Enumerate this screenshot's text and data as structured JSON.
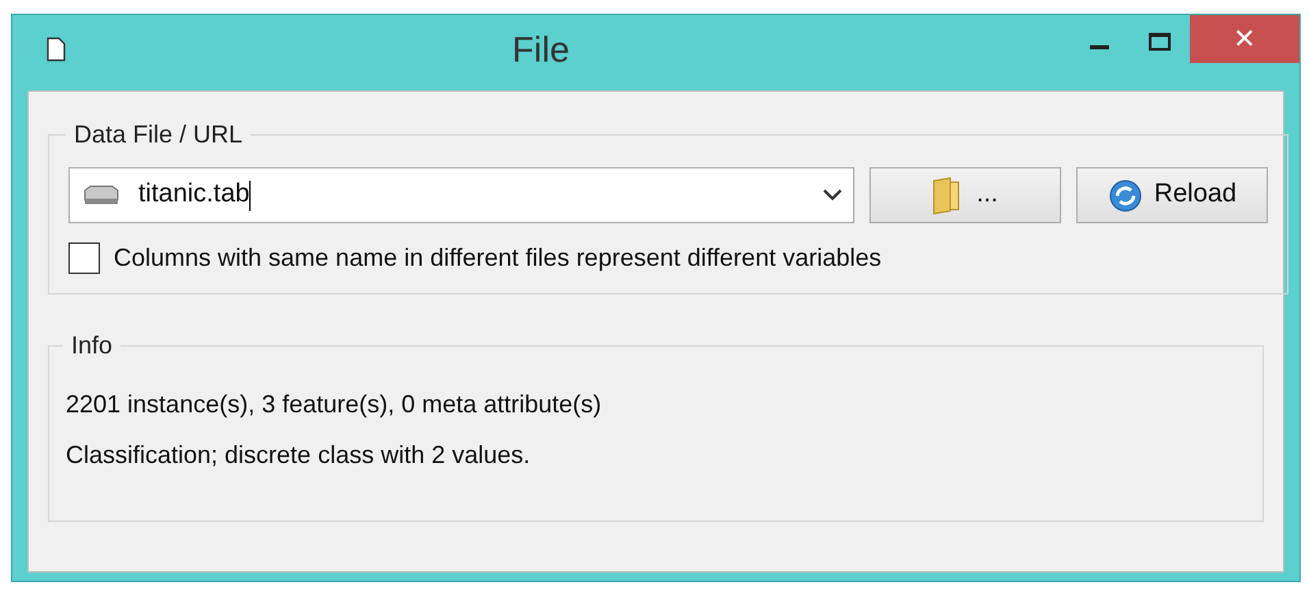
{
  "window": {
    "title": "File",
    "close": "✕"
  },
  "data_file": {
    "legend": "Data File / URL",
    "combo": {
      "value": "titanic.tab"
    },
    "browse_button": {
      "label": "..."
    },
    "reload_button": {
      "label": "Reload"
    },
    "checkbox": {
      "label": "Columns with same name in different files represent different variables",
      "checked": false
    }
  },
  "info": {
    "legend": "Info",
    "lines": [
      "2201 instance(s), 3 feature(s), 0 meta attribute(s)",
      "Classification; discrete class with 2 values."
    ]
  }
}
